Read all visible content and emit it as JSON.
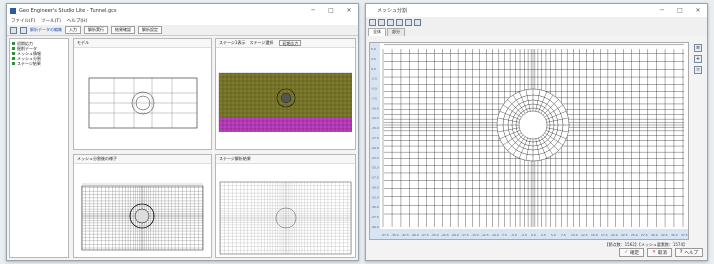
{
  "win1": {
    "title": "Geo Engineer's Studio Lite - Tunnel.gcs",
    "menu": [
      "ファイル(F)",
      "ツール(T)",
      "ヘルプ(H)"
    ],
    "toolbar": {
      "link": "解析データの編集",
      "btn1": "入力",
      "btn2": "解析実行",
      "btn3": "結果確認",
      "btn4": "解析設定"
    },
    "tree": [
      "初期応力",
      "掘削データ",
      "メッシュ情報",
      "メッシュ分割",
      "ステージ結果"
    ],
    "panels": {
      "model": "モデル",
      "stage": "ステージ1表示",
      "stage_select_label": "ステージ選択",
      "stage_select_value": "初期応力",
      "mesh": "メッシュ分割後の様子",
      "stage_result": "ステージ解析結果"
    }
  },
  "win2": {
    "title": "メッシュ分割",
    "tabs": [
      "全体",
      "部分"
    ],
    "status": "【節点数：1562】【メッシュ要素数：1574】",
    "footer": {
      "ok": "確定",
      "cancel": "取消",
      "help": "ヘルプ"
    },
    "y_ticks": [
      "5.0",
      "2.5",
      "0.0",
      "-2.5",
      "-5.0",
      "-7.5",
      "-10.0",
      "-12.5",
      "-15.0",
      "-17.5",
      "-20.0",
      "-22.5",
      "-25.0",
      "-27.5",
      "-30.0",
      "-32.5",
      "-35.0",
      "-37.5",
      "-40.0"
    ],
    "x_ticks": [
      "-37.5",
      "-35.0",
      "-32.5",
      "-30.0",
      "-27.5",
      "-25.0",
      "-22.5",
      "-20.0",
      "-17.5",
      "-15.0",
      "-12.5",
      "-10.0",
      "-7.5",
      "-5.0",
      "-2.5",
      "0.0",
      "2.5",
      "5.0",
      "7.5",
      "10.0",
      "12.5",
      "15.0",
      "17.5",
      "20.0",
      "22.5",
      "25.0",
      "27.5",
      "30.0",
      "32.5",
      "35.0",
      "37.5"
    ]
  }
}
